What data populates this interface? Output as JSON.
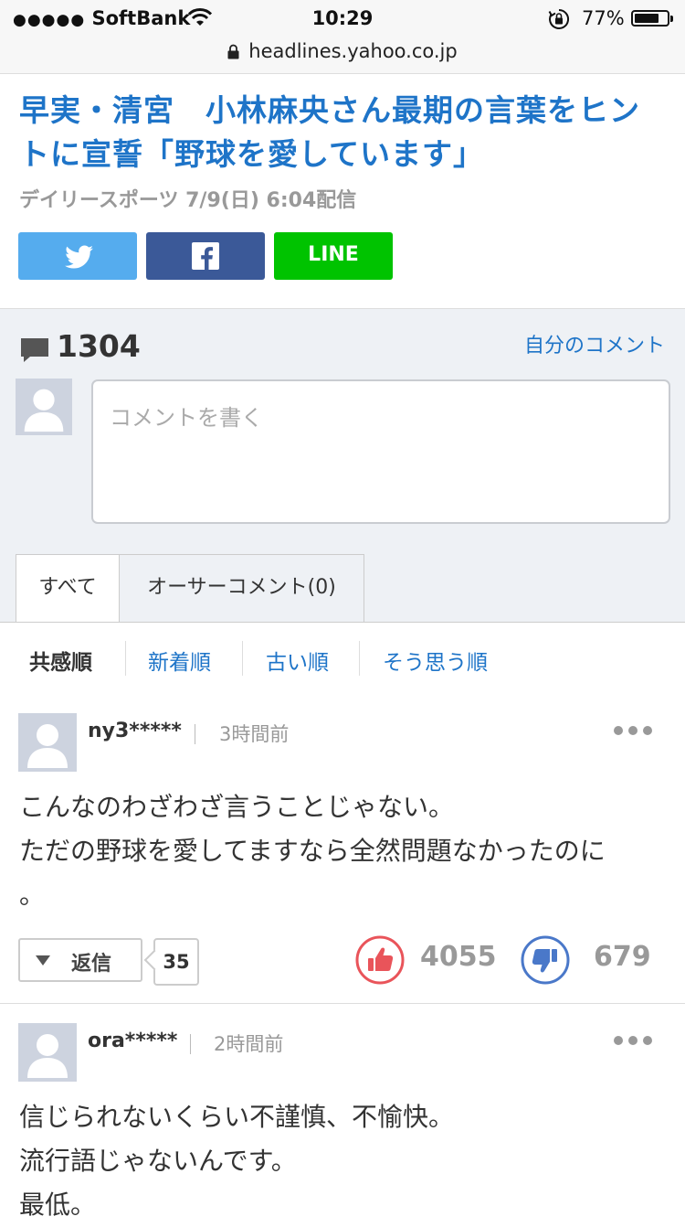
{
  "status_bar": {
    "carrier_dots": "●●●●●",
    "carrier": "SoftBank",
    "time": "10:29",
    "battery_percent": "77%",
    "battery_level": 0.77
  },
  "browser": {
    "url": "headlines.yahoo.co.jp"
  },
  "article": {
    "title": "早実・清宮　小林麻央さん最期の言葉をヒントに宣誓「野球を愛しています」",
    "meta": "デイリースポーツ  7/9(日) 6:04配信",
    "share": {
      "line_label": "LINE"
    }
  },
  "comments": {
    "count": "1304",
    "my_comments_link": "自分のコメント",
    "input_placeholder": "コメントを書く",
    "tabs": [
      "すべて",
      "オーサーコメント(0)"
    ],
    "sort_options": [
      "共感順",
      "新着順",
      "古い順",
      "そう思う順"
    ],
    "items": [
      {
        "user": "ny3*****",
        "time": "3時間前",
        "lines": [
          "こんなのわざわざ言うことじゃない。",
          "ただの野球を愛してますなら全然問題なかったのに",
          "。"
        ],
        "reply_label": "返信",
        "reply_count": "35",
        "likes": "4055",
        "dislikes": "679"
      },
      {
        "user": "ora*****",
        "time": "2時間前",
        "lines": [
          "信じられないくらい不謹慎、不愉快。",
          "流行語じゃないんです。",
          "最低。"
        ]
      }
    ]
  },
  "colors": {
    "link_blue": "#1e74c8",
    "twitter": "#55acee",
    "facebook": "#3b5998",
    "line": "#00c300",
    "like_red": "#e9545a",
    "dislike_blue": "#4a78c9"
  }
}
